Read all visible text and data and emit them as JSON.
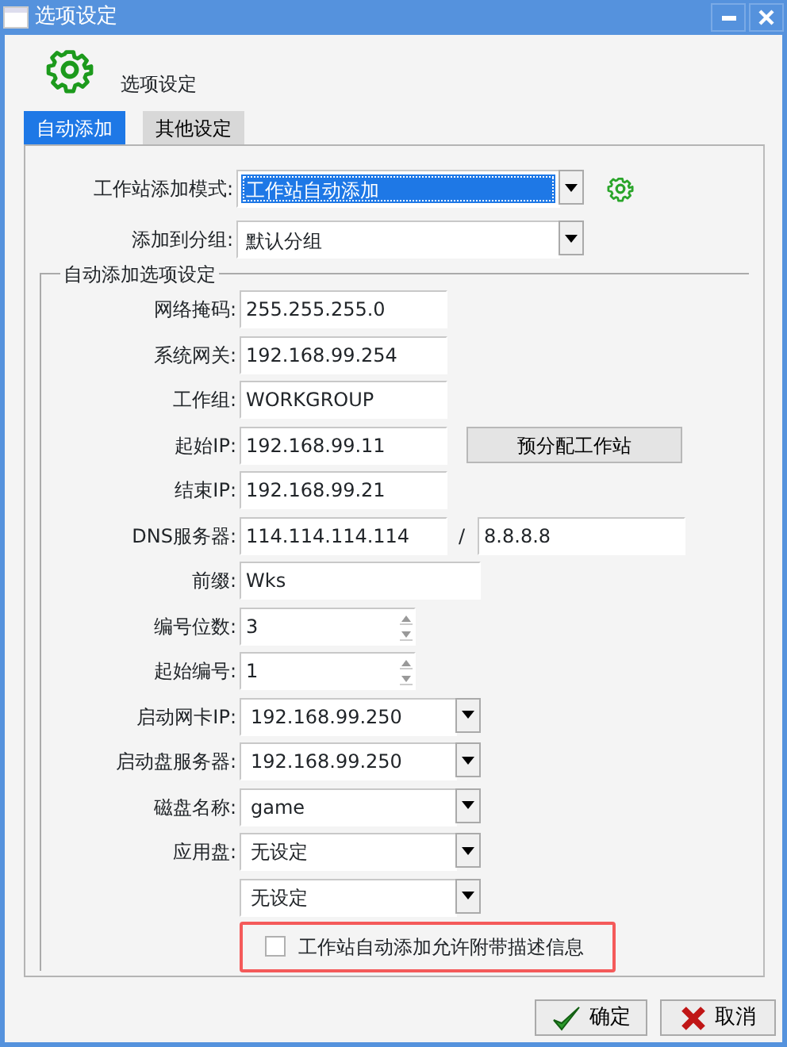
{
  "window": {
    "title": "选项设定"
  },
  "header": {
    "title": "选项设定"
  },
  "tabs": [
    {
      "label": "自动添加",
      "selected": true
    },
    {
      "label": "其他设定",
      "selected": false
    }
  ],
  "mode_fields": [
    {
      "label": "工作站添加模式:",
      "value": "工作站自动添加",
      "selected": true,
      "gear": true
    },
    {
      "label": "添加到分组:",
      "value": "默认分组",
      "selected": false,
      "gear": false
    }
  ],
  "group": {
    "title": "自动添加选项设定",
    "rows": [
      {
        "kind": "text",
        "label": "网络掩码:",
        "value": "255.255.255.0"
      },
      {
        "kind": "text",
        "label": "系统网关:",
        "value": "192.168.99.254"
      },
      {
        "kind": "text",
        "label": "工作组:",
        "value": "WORKGROUP"
      },
      {
        "kind": "text",
        "label": "起始IP:",
        "value": "192.168.99.11",
        "button": "预分配工作站"
      },
      {
        "kind": "text",
        "label": "结束IP:",
        "value": "192.168.99.21"
      },
      {
        "kind": "pair",
        "label": "DNS服务器:",
        "value": "114.114.114.114",
        "separator": "/",
        "value2": "8.8.8.8"
      },
      {
        "kind": "long",
        "label": "前缀:",
        "value": "Wks"
      },
      {
        "kind": "spin",
        "label": "编号位数:",
        "value": "3"
      },
      {
        "kind": "spin",
        "label": "起始编号:",
        "value": "1"
      },
      {
        "kind": "select",
        "label": "启动网卡IP:",
        "value": "192.168.99.250"
      },
      {
        "kind": "select",
        "label": "启动盘服务器:",
        "value": "192.168.99.250"
      },
      {
        "kind": "select",
        "label": "磁盘名称:",
        "value": "game"
      },
      {
        "kind": "select",
        "label": "应用盘:",
        "value": "无设定"
      },
      {
        "kind": "select",
        "value": "无设定"
      }
    ]
  },
  "checkbox": {
    "label": "工作站自动添加允许附带描述信息",
    "checked": false,
    "highlighted": true
  },
  "buttons": [
    {
      "kind": "ok",
      "label": "确定"
    },
    {
      "kind": "cancel",
      "label": "取消"
    }
  ]
}
